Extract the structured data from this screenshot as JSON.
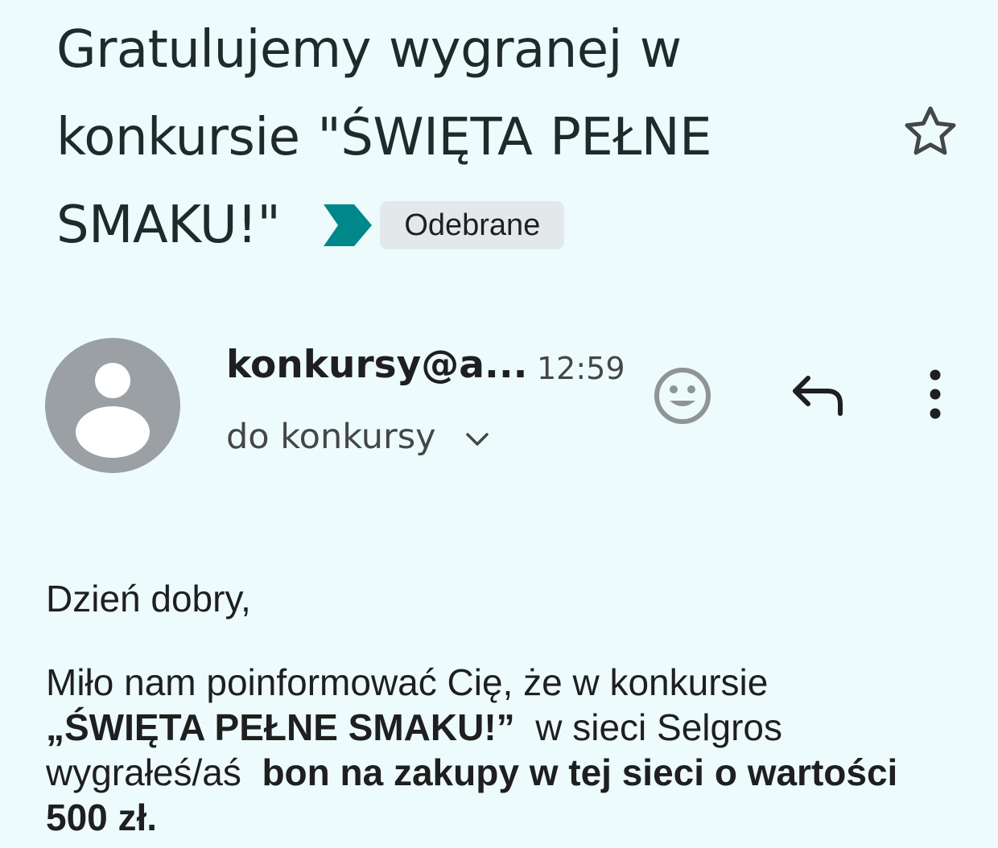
{
  "subject": "Gratulujemy wygranej w konkursie \"ŚWIĘTA PEŁNE SMAKU!\"",
  "label": "Odebrane",
  "sender": "konkursy@a...",
  "time": "12:59",
  "recipient": "do konkursy",
  "icons": {
    "label_arrow": "label-important-icon",
    "star": "star-outline-icon",
    "avatar": "person-avatar-icon",
    "chevron": "chevron-down-icon",
    "emoji": "add-reaction-icon",
    "reply": "reply-icon",
    "more": "more-vert-icon"
  },
  "colors": {
    "background": "#eefbfc",
    "label_arrow": "#00878a",
    "avatar": "#9aa0a4",
    "chip": "#e3e9ea"
  },
  "body": {
    "greeting": "Dzień dobry,",
    "p1_part1": "Miło nam poinformować Cię, że w konkursie ",
    "p1_bold1": "„ŚWIĘTA PEŁNE SMAKU!”",
    "p1_part2": "  w sieci Selgros wygrałeś/aś  ",
    "p1_bold2": "bon na zakupy w tej sieci o wartości 500 zł."
  }
}
